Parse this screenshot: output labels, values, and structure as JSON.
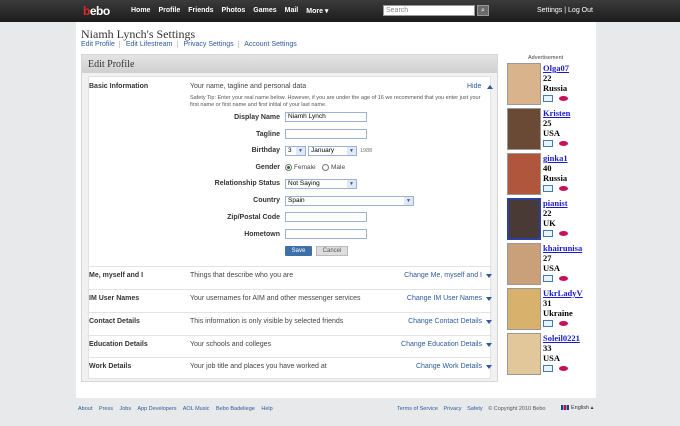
{
  "topbar": {
    "logo_b": "b",
    "logo_rest": "ebo",
    "nav": [
      "Home",
      "Profile",
      "Friends",
      "Photos",
      "Games",
      "Mail",
      "More ▾"
    ],
    "search_placeholder": "Search",
    "settings": "Settings",
    "separator": "|",
    "logout": "Log Out"
  },
  "page": {
    "title": "Niamh Lynch's Settings",
    "sublinks": [
      "Edit Profile",
      "Edit Lifestream",
      "Privacy Settings",
      "Account Settings"
    ]
  },
  "panel": {
    "title": "Edit Profile",
    "basic": {
      "label": "Basic Information",
      "desc": "Your name, tagline and personal data",
      "hide": "Hide",
      "tip": "Safety Tip: Enter your real name below. However, if you are under the age of 16 we recommend that you enter just your first name or first name and first initial of your last name."
    },
    "form": {
      "display_name_label": "Display Name",
      "display_name_value": "Niamh Lynch",
      "tagline_label": "Tagline",
      "birthday_label": "Birthday",
      "birthday_day": "3",
      "birthday_month": "January",
      "birthday_year_hint": "1988",
      "gender_label": "Gender",
      "gender_female": "Female",
      "gender_male": "Male",
      "relationship_label": "Relationship Status",
      "relationship_value": "Not Saying",
      "country_label": "Country",
      "country_value": "Spain",
      "zip_label": "Zip/Postal Code",
      "hometown_label": "Hometown",
      "save": "Save",
      "cancel": "Cancel"
    },
    "sections": [
      {
        "label": "Me, myself and I",
        "desc": "Things that describe who you are",
        "change": "Change Me, myself and I"
      },
      {
        "label": "IM User Names",
        "desc": "Your usernames for AIM and other messenger services",
        "change": "Change IM User Names"
      },
      {
        "label": "Contact Details",
        "desc": "This information is only visible by selected friends",
        "change": "Change Contact Details"
      },
      {
        "label": "Education Details",
        "desc": "Your schools and colleges",
        "change": "Change Education Details"
      },
      {
        "label": "Work Details",
        "desc": "Your job title and places you have worked at",
        "change": "Change Work Details"
      }
    ]
  },
  "ads": {
    "label": "Advertisement",
    "items": [
      {
        "name": "Olga07",
        "age": "22",
        "country": "Russia",
        "color": "#d9b38c"
      },
      {
        "name": "Kristen",
        "age": "25",
        "country": "USA",
        "color": "#6b4a35"
      },
      {
        "name": "ginka1",
        "age": "40",
        "country": "Russia",
        "color": "#b0563c"
      },
      {
        "name": "pianist",
        "age": "22",
        "country": "UK",
        "color": "#4a3a35"
      },
      {
        "name": "khairunisa",
        "age": "27",
        "country": "USA",
        "color": "#c9a07a"
      },
      {
        "name": "UkrLadyV",
        "age": "31",
        "country": "Ukraine",
        "color": "#d8b16d"
      },
      {
        "name": "Soleil0221",
        "age": "33",
        "country": "USA",
        "color": "#e2c79a"
      }
    ]
  },
  "footer": {
    "links": [
      "About",
      "Press",
      "Jobs",
      "App Developers",
      "AOL Music",
      "Bebo Badeliege",
      "Help"
    ],
    "right": [
      "Terms of Service",
      "Privacy",
      "Safety"
    ],
    "copyright": "© Copyright 2010 Bebo",
    "language": "English ▴"
  }
}
